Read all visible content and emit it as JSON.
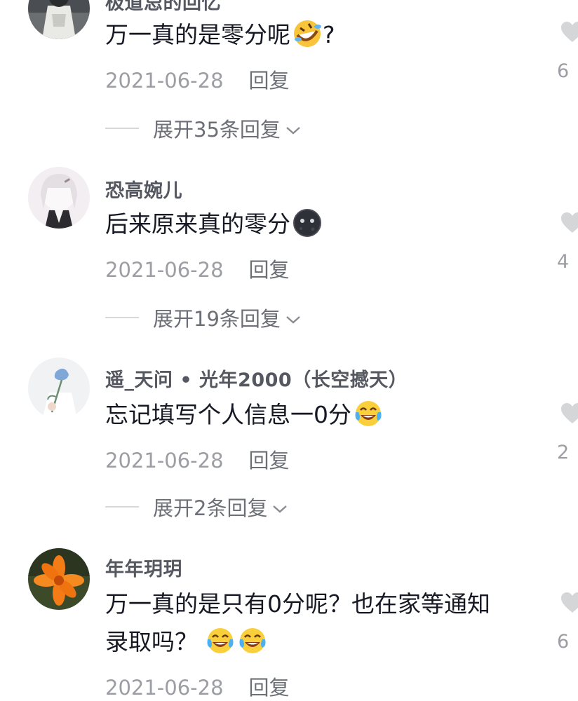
{
  "comments": [
    {
      "username": "极道忌的回忆",
      "text": "万一真的是零分呢",
      "emoji_names": [
        "rofl-emoji-icon"
      ],
      "text_suffix": "?",
      "date": "2021-06-28",
      "reply_label": "回复",
      "expand_label": "展开35条回复",
      "like_count": "6"
    },
    {
      "username": "恐高婉儿",
      "text": "后来原来真的零分",
      "emoji_names": [
        "black-moon-face-emoji-icon"
      ],
      "text_suffix": "",
      "date": "2021-06-28",
      "reply_label": "回复",
      "expand_label": "展开19条回复",
      "like_count": "4"
    },
    {
      "username": "遥_天问 • 光年2000（长空撼天）",
      "text": "忘记填写个人信息一0分",
      "emoji_names": [
        "crying-laughing-emoji-icon"
      ],
      "text_suffix": "",
      "date": "2021-06-28",
      "reply_label": "回复",
      "expand_label": "展开2条回复",
      "like_count": "2"
    },
    {
      "username": "年年玥玥",
      "text_line1": "万一真的是只有0分呢？也在家等通知",
      "text_line2": "录取吗？",
      "emoji_names": [
        "crying-laughing-emoji-icon",
        "crying-laughing-emoji-icon"
      ],
      "date": "2021-06-28",
      "reply_label": "回复",
      "like_count": "6"
    }
  ],
  "colors": {
    "username": "#555861",
    "body_text": "#161823",
    "meta": "#9c9ea4",
    "like_icon": "#d5d6d8"
  }
}
